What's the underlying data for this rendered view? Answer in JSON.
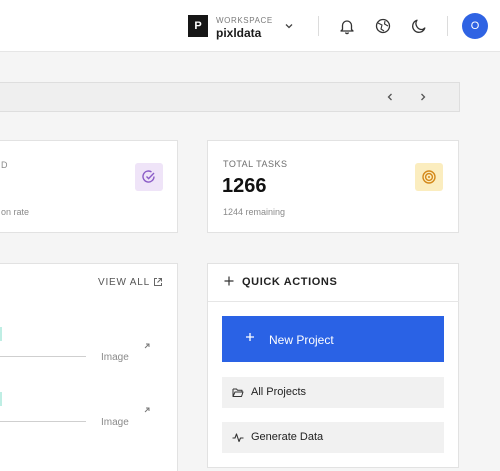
{
  "header": {
    "workspace_logo_letter": "P",
    "workspace_label": "WORKSPACE",
    "workspace_name": "pixldata",
    "avatar_initial": "O",
    "icons": [
      "chevron-down-icon",
      "bell-icon",
      "globe-icon",
      "moon-icon"
    ]
  },
  "pager": {
    "icons": [
      "chevron-left-icon",
      "chevron-right-icon"
    ]
  },
  "stats": {
    "left_card": {
      "label_tail": "D",
      "subtext_tail": "on rate",
      "icon": "check-circle-icon",
      "badge_color": "#efe4f8"
    },
    "total_tasks": {
      "label": "TOTAL TASKS",
      "value": "1266",
      "subtext": "1244 remaining",
      "icon": "target-icon",
      "badge_color": "#fbedbf"
    }
  },
  "recent": {
    "view_all_label": "VIEW ALL",
    "items": [
      {
        "tag": "Image"
      },
      {
        "tag": "Image"
      }
    ]
  },
  "quick_actions": {
    "title": "QUICK ACTIONS",
    "buttons": {
      "new_project": "New Project",
      "all_projects": "All Projects",
      "generate_data": "Generate Data"
    }
  },
  "colors": {
    "primary": "#2a62e5",
    "avatar": "#2f63e3"
  }
}
